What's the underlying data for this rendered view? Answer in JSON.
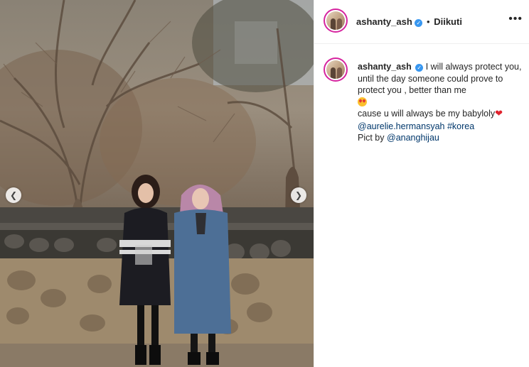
{
  "post": {
    "image_alt": "Two women standing in front of a stone wall under bare trees",
    "prev_icon": "chevron-left-icon",
    "next_icon": "chevron-right-icon"
  },
  "header": {
    "username": "ashanty_ash",
    "verified_icon": "verified-badge-icon",
    "separator": "•",
    "follow_status": "Diikuti",
    "more_label": "•••"
  },
  "caption": {
    "username": "ashanty_ash",
    "text_line1": "I will always protect you, until the day someone could prove to protect you , better than me",
    "emoji1": "star-struck-emoji",
    "text_line2": "cause u will always be my babyloly",
    "heart": "❤",
    "mention1": "@aurelie.hermansyah",
    "hashtag1": "#korea",
    "credit_prefix": "Pict by",
    "mention2": "@ananghijau"
  },
  "colors": {
    "link": "#00376b",
    "verified": "#3897f0",
    "story_ring": "#d6249f"
  }
}
